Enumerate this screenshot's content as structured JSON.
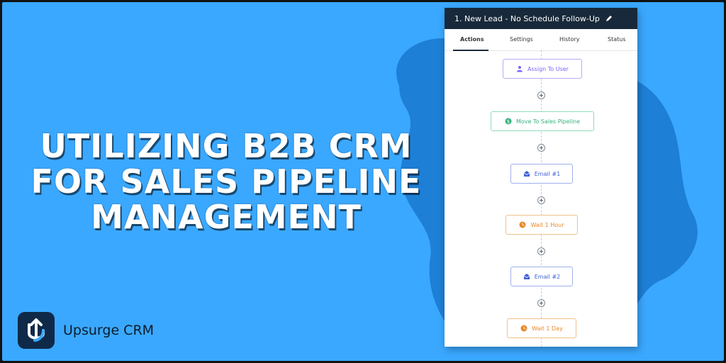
{
  "headline": {
    "line1": "UTILIZING B2B CRM",
    "line2": "FOR SALES PIPELINE",
    "line3": "MANAGEMENT"
  },
  "brand": {
    "name": "Upsurge CRM",
    "logo_icon": "upsurge-logo-icon"
  },
  "workflow": {
    "title": "1. New Lead - No Schedule Follow-Up",
    "edit_icon": "pencil-icon",
    "tabs": [
      {
        "label": "Actions",
        "active": true
      },
      {
        "label": "Settings",
        "active": false
      },
      {
        "label": "History",
        "active": false
      },
      {
        "label": "Status",
        "active": false
      }
    ],
    "steps": [
      {
        "label": "Assign To User",
        "icon": "user-icon",
        "color": "#7b61ff"
      },
      {
        "label": "Move To Sales Pipeline",
        "icon": "dollar-icon",
        "color": "#34b27d"
      },
      {
        "label": "Email #1",
        "icon": "email-icon",
        "color": "#3f5fd8"
      },
      {
        "label": "Wait 1 Hour",
        "icon": "clock-icon",
        "color": "#e8892b"
      },
      {
        "label": "Email #2",
        "icon": "email-icon",
        "color": "#3f5fd8"
      },
      {
        "label": "Wait 1 Day",
        "icon": "clock-icon",
        "color": "#e8892b"
      }
    ],
    "add_icon": "plus-circle-icon"
  },
  "colors": {
    "background": "#3aa8ff",
    "blob": "#1e7fd6",
    "panel_header": "#17293a",
    "logo_bg": "#0f2a48"
  }
}
